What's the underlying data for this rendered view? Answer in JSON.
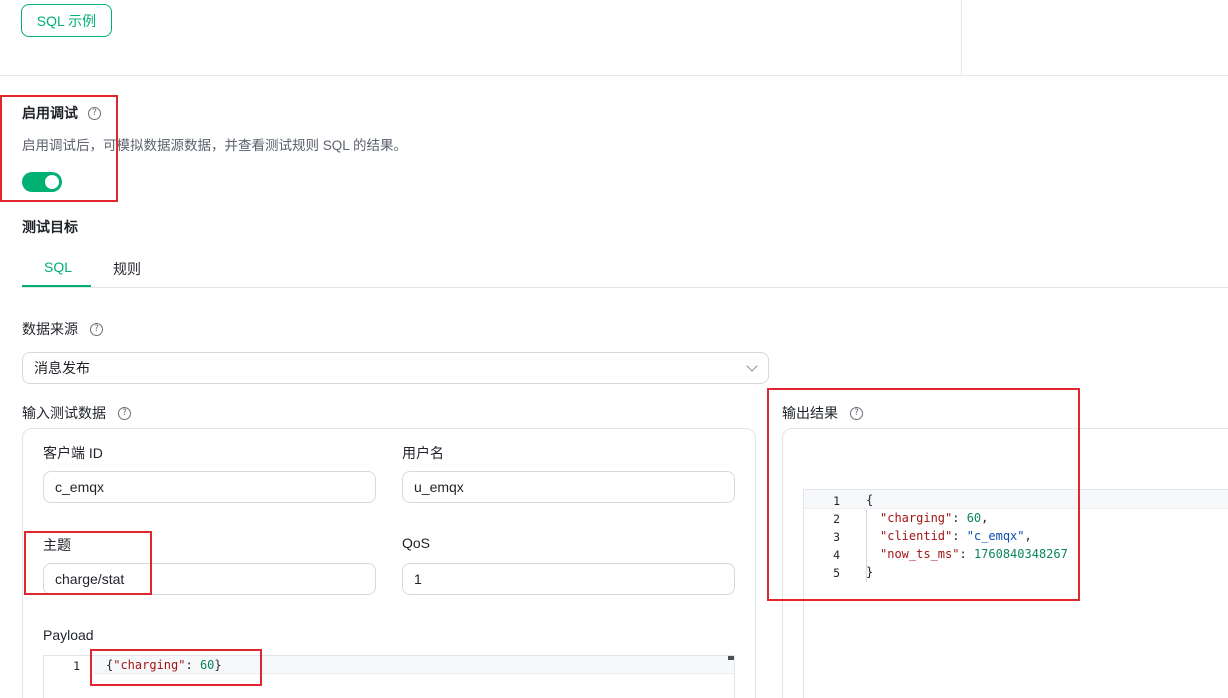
{
  "toolbar": {
    "sql_example_label": "SQL 示例"
  },
  "debug": {
    "title": "启用调试",
    "description": "启用调试后，可模拟数据源数据，并查看测试规则 SQL 的结果。",
    "enabled": true
  },
  "test_target": {
    "title": "测试目标",
    "tabs": [
      {
        "label": "SQL",
        "active": true
      },
      {
        "label": "规则",
        "active": false
      }
    ]
  },
  "data_source": {
    "label": "数据来源",
    "selected": "消息发布"
  },
  "input": {
    "label": "输入测试数据",
    "client_id_label": "客户端 ID",
    "client_id_value": "c_emqx",
    "username_label": "用户名",
    "username_value": "u_emqx",
    "topic_label": "主题",
    "topic_value": "charge/stat",
    "qos_label": "QoS",
    "qos_value": "1",
    "payload_label": "Payload",
    "payload_line_number": "1",
    "payload_tokens": [
      "{",
      "\"charging\"",
      ": ",
      "60",
      "}"
    ]
  },
  "output": {
    "label": "输出结果",
    "line_numbers": [
      "1",
      "2",
      "3",
      "4",
      "5"
    ],
    "lines": [
      {
        "open": "{"
      },
      {
        "key": "\"charging\"",
        "sep": ": ",
        "value": "60",
        "type": "num",
        "end": ","
      },
      {
        "key": "\"clientid\"",
        "sep": ": ",
        "value": "\"c_emqx\"",
        "type": "str",
        "end": ","
      },
      {
        "key": "\"now_ts_ms\"",
        "sep": ": ",
        "value": "1760840348267",
        "type": "num",
        "end": ""
      },
      {
        "open": "}"
      }
    ]
  },
  "icons": {
    "help": "question-circle-icon",
    "dropdown": "chevron-down-icon"
  },
  "colors": {
    "accent": "#00b173",
    "annotation": "#e0262f"
  }
}
